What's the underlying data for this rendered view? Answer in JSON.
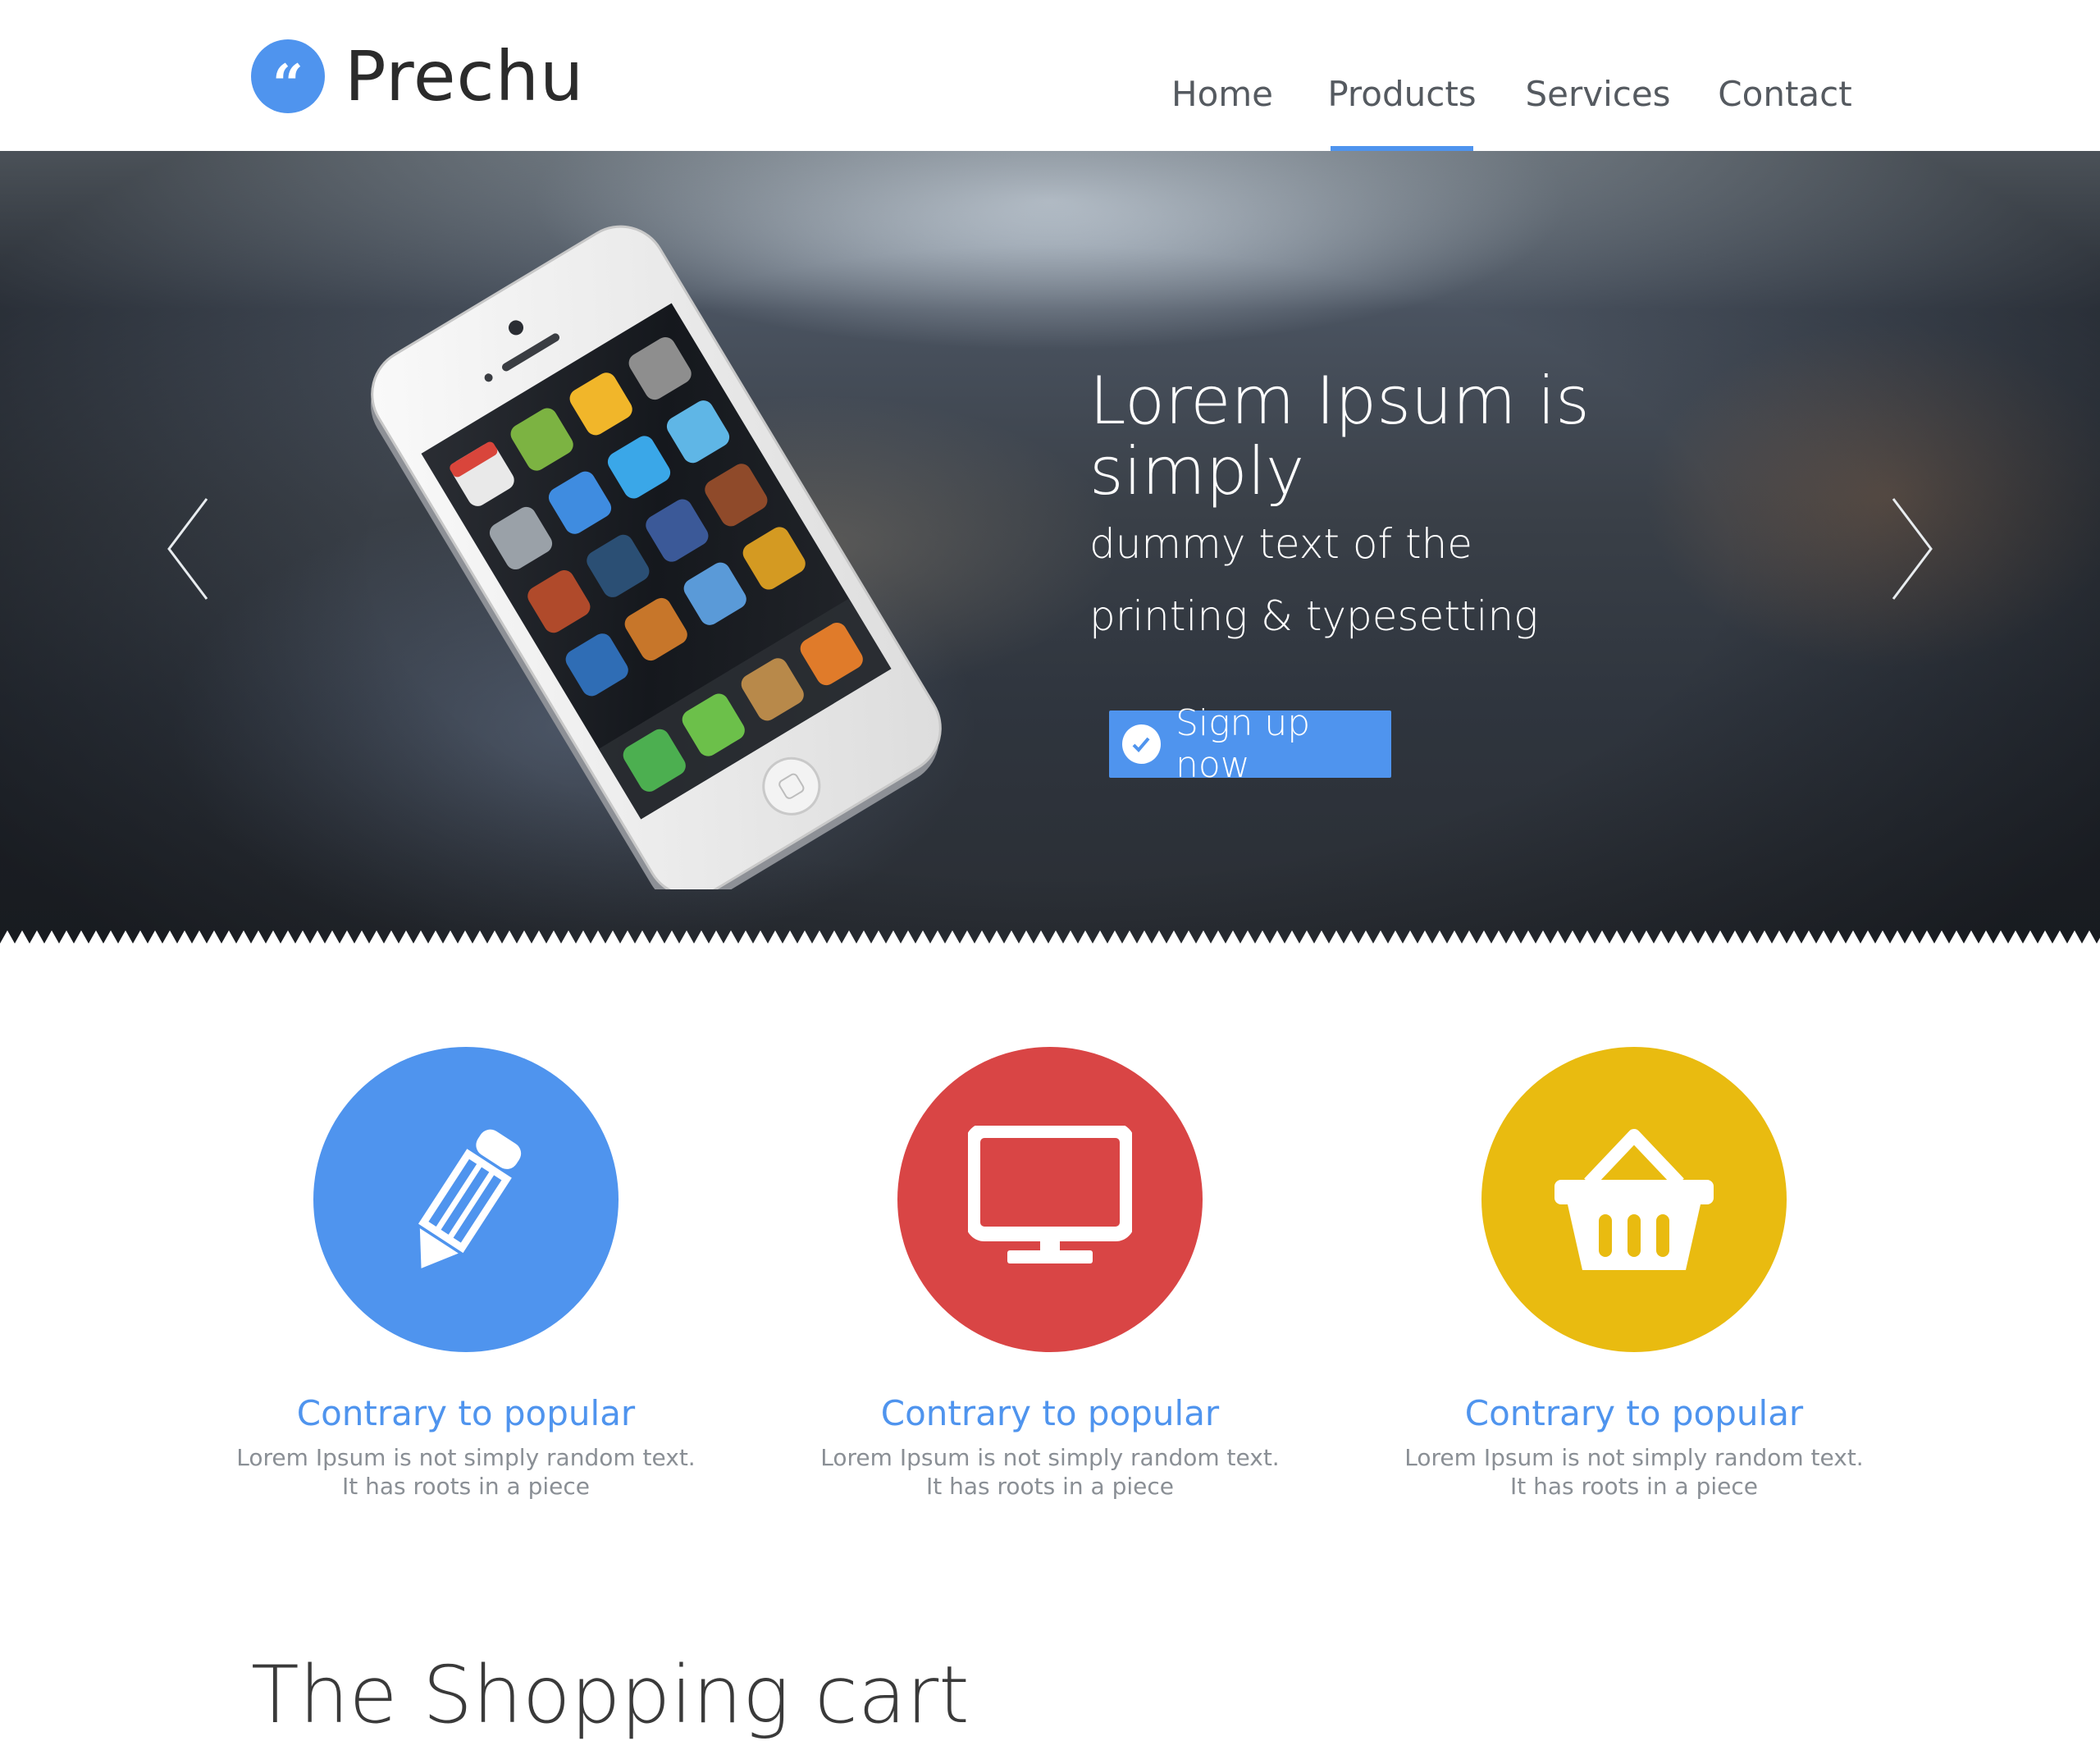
{
  "brand": {
    "logo_mark": "“",
    "name": "Prechu",
    "accent_color": "#4f94ee"
  },
  "nav": {
    "items": [
      {
        "label": "Home",
        "active": false
      },
      {
        "label": "Products",
        "active": true
      },
      {
        "label": "Services",
        "active": false
      },
      {
        "label": "Contact",
        "active": false
      }
    ]
  },
  "hero": {
    "title": "Lorem Ipsum is simply",
    "subtitle_line1": "dummy text of the",
    "subtitle_line2": "printing & typesetting",
    "cta_label": "Sign up now",
    "cta_icon": "check-circle-icon",
    "prev_icon": "chevron-left-icon",
    "next_icon": "chevron-right-icon",
    "image": "smartphone-photo"
  },
  "features": [
    {
      "icon": "pencil-icon",
      "color": "#4f94ee",
      "title": "Contrary to popular",
      "desc_line1": "Lorem Ipsum is not simply random text.",
      "desc_line2": "It has roots in a piece"
    },
    {
      "icon": "monitor-icon",
      "color": "#d94545",
      "title": "Contrary to popular",
      "desc_line1": "Lorem Ipsum is not simply random text.",
      "desc_line2": "It has roots in a piece"
    },
    {
      "icon": "basket-icon",
      "color": "#e9bb10",
      "title": "Contrary to popular",
      "desc_line1": "Lorem Ipsum is not simply random text.",
      "desc_line2": "It has roots in a piece"
    }
  ],
  "section_heading": "The Shopping cart"
}
